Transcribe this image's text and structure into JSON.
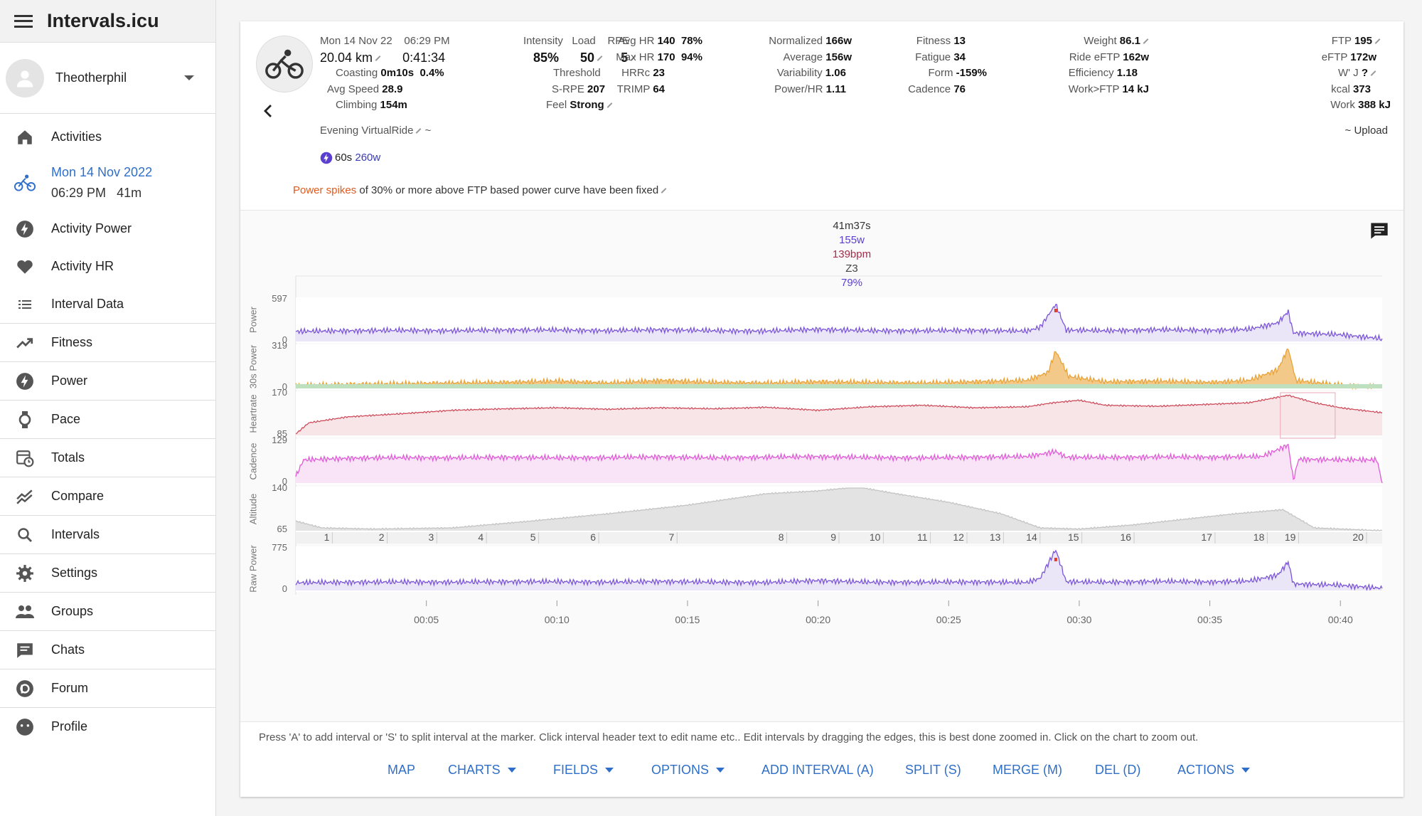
{
  "app": {
    "title": "Intervals.icu"
  },
  "user": {
    "name": "Theotherphil"
  },
  "sidebar": {
    "items": [
      {
        "label": "Activities",
        "icon": "home-icon"
      },
      {
        "label": "Activity Power",
        "icon": "lightning-icon"
      },
      {
        "label": "Activity HR",
        "icon": "heart-icon"
      },
      {
        "label": "Interval Data",
        "icon": "list-icon"
      },
      {
        "label": "Fitness",
        "icon": "trending-up-icon"
      },
      {
        "label": "Power",
        "icon": "lightning-icon"
      },
      {
        "label": "Pace",
        "icon": "watch-icon"
      },
      {
        "label": "Totals",
        "icon": "calendar-clock-icon"
      },
      {
        "label": "Compare",
        "icon": "compare-icon"
      },
      {
        "label": "Intervals",
        "icon": "search-icon"
      },
      {
        "label": "Settings",
        "icon": "gear-icon"
      },
      {
        "label": "Groups",
        "icon": "people-icon"
      },
      {
        "label": "Chats",
        "icon": "chat-icon"
      },
      {
        "label": "Forum",
        "icon": "discourse-icon"
      },
      {
        "label": "Profile",
        "icon": "profile-icon"
      }
    ],
    "current": {
      "date": "Mon 14 Nov 2022",
      "time": "06:29 PM",
      "duration": "41m"
    }
  },
  "activity": {
    "date": "Mon 14 Nov 22",
    "time": "06:29 PM",
    "distance": "20.04 km",
    "elapsed": "0:41:34",
    "coasting_label": "Coasting",
    "coasting": "0m10s",
    "coasting_pct": "0.4%",
    "avg_speed_label": "Avg Speed",
    "avg_speed": "28.9",
    "climbing_label": "Climbing",
    "climbing": "154m",
    "name": "Evening VirtualRide",
    "name_suffix": "~",
    "peak": "60s",
    "peak_value": "260w",
    "upload": "~ Upload",
    "notice_highlight": "Power spikes",
    "notice_rest": "of 30% or more above FTP based power curve have been fixed"
  },
  "stats": {
    "intensity_label": "Intensity",
    "intensity": "85%",
    "load_label": "Load",
    "load": "50",
    "rpe_label": "RPE",
    "rpe": "5",
    "threshold_label": "Threshold",
    "srpe_label": "S-RPE",
    "srpe": "207",
    "feel_label": "Feel",
    "feel": "Strong",
    "avg_hr_label": "Avg HR",
    "avg_hr": "140",
    "avg_hr_pct": "78%",
    "max_hr_label": "Max HR",
    "max_hr": "170",
    "max_hr_pct": "94%",
    "hrrc_label": "HRRc",
    "hrrc": "23",
    "trimp_label": "TRIMP",
    "trimp": "64",
    "normalized_label": "Normalized",
    "normalized": "166w",
    "average_label": "Average",
    "average": "156w",
    "variability_label": "Variability",
    "variability": "1.06",
    "powerhr_label": "Power/HR",
    "powerhr": "1.11",
    "fitness_label": "Fitness",
    "fitness": "13",
    "fatigue_label": "Fatigue",
    "fatigue": "34",
    "form_label": "Form",
    "form": "-159%",
    "cadence_label": "Cadence",
    "cadence": "76",
    "weight_label": "Weight",
    "weight": "86.1",
    "ride_eftp_label": "Ride eFTP",
    "ride_eftp": "162w",
    "efficiency_label": "Efficiency",
    "efficiency": "1.18",
    "work_ftp_label": "Work>FTP",
    "work_ftp": "14 kJ",
    "ftp_label": "FTP",
    "ftp": "195",
    "eftp_label": "eFTP",
    "eftp": "172w",
    "wj_label": "W' J",
    "wj": "?",
    "kcal_label": "kcal",
    "kcal": "373",
    "work_label": "Work",
    "work": "388 kJ"
  },
  "summary": {
    "duration": "41m37s",
    "power": "155w",
    "hr": "139bpm",
    "zone": "Z3",
    "pct": "79%"
  },
  "chart_data": {
    "type": "line",
    "x_ticks": [
      "00:05",
      "00:10",
      "00:15",
      "00:20",
      "00:25",
      "00:30",
      "00:35",
      "00:40"
    ],
    "x_tick_minutes": [
      5,
      10,
      15,
      20,
      25,
      30,
      35,
      40
    ],
    "x_range_minutes": [
      0,
      41.6
    ],
    "km_markers": [
      "1",
      "2",
      "3",
      "4",
      "5",
      "6",
      "7",
      "8",
      "9",
      "10",
      "11",
      "12",
      "13",
      "14",
      "15",
      "16",
      "17",
      "18",
      "19",
      "20"
    ],
    "km_marker_minutes": [
      1.4,
      3.5,
      5.4,
      7.3,
      9.3,
      11.6,
      14.6,
      18.8,
      20.8,
      22.5,
      24.3,
      25.7,
      27.1,
      28.5,
      30.1,
      32.1,
      35.2,
      37.2,
      38.4,
      41.0
    ],
    "panels": [
      {
        "name": "Power",
        "ymin_label": "0",
        "ymax_label": "597",
        "ymax": 597,
        "color": "#7b55d9",
        "fill": "#ebe6f7",
        "points": [
          [
            0,
            140
          ],
          [
            2,
            150
          ],
          [
            4,
            155
          ],
          [
            6,
            150
          ],
          [
            8,
            160
          ],
          [
            10,
            160
          ],
          [
            12,
            150
          ],
          [
            14,
            165
          ],
          [
            16,
            150
          ],
          [
            18,
            145
          ],
          [
            20,
            170
          ],
          [
            22,
            150
          ],
          [
            24,
            150
          ],
          [
            26,
            155
          ],
          [
            28,
            145
          ],
          [
            28.5,
            200
          ],
          [
            29.1,
            520
          ],
          [
            29.5,
            160
          ],
          [
            31,
            150
          ],
          [
            33,
            165
          ],
          [
            35,
            155
          ],
          [
            36.5,
            170
          ],
          [
            37.6,
            260
          ],
          [
            38,
            420
          ],
          [
            38.2,
            120
          ],
          [
            40,
            95
          ],
          [
            41.6,
            40
          ]
        ]
      },
      {
        "name": "30s Power",
        "ymin_label": "0",
        "ymax_label": "319",
        "ymax": 319,
        "color": "#e8a33a",
        "fill": "#f3c98a",
        "points": [
          [
            0,
            20
          ],
          [
            2,
            30
          ],
          [
            4,
            35
          ],
          [
            6,
            40
          ],
          [
            8,
            45
          ],
          [
            10,
            55
          ],
          [
            12,
            40
          ],
          [
            14,
            60
          ],
          [
            16,
            45
          ],
          [
            18,
            40
          ],
          [
            20,
            50
          ],
          [
            22,
            45
          ],
          [
            24,
            40
          ],
          [
            26,
            50
          ],
          [
            28,
            60
          ],
          [
            28.8,
            120
          ],
          [
            29.1,
            280
          ],
          [
            29.6,
            90
          ],
          [
            31,
            50
          ],
          [
            33,
            55
          ],
          [
            35,
            45
          ],
          [
            36.5,
            60
          ],
          [
            37.6,
            140
          ],
          [
            38,
            300
          ],
          [
            38.3,
            60
          ],
          [
            40,
            25
          ],
          [
            41.6,
            10
          ]
        ]
      },
      {
        "name": "Heartrate",
        "ymin_label": "85",
        "ymax_label": "170",
        "ymax": 170,
        "ymin": 85,
        "color": "#cf4d5c",
        "fill": "#f8e5e8",
        "points": [
          [
            0,
            88
          ],
          [
            0.5,
            110
          ],
          [
            2,
            122
          ],
          [
            4,
            128
          ],
          [
            6,
            135
          ],
          [
            8,
            138
          ],
          [
            10,
            140
          ],
          [
            12,
            137
          ],
          [
            14,
            140
          ],
          [
            16,
            138
          ],
          [
            18,
            141
          ],
          [
            20,
            135
          ],
          [
            22,
            142
          ],
          [
            24,
            145
          ],
          [
            26,
            140
          ],
          [
            28,
            142
          ],
          [
            29,
            150
          ],
          [
            30,
            155
          ],
          [
            31,
            145
          ],
          [
            33,
            143
          ],
          [
            35,
            147
          ],
          [
            36.5,
            150
          ],
          [
            37.5,
            160
          ],
          [
            38,
            165
          ],
          [
            39,
            150
          ],
          [
            40,
            140
          ],
          [
            41.6,
            130
          ]
        ]
      },
      {
        "name": "Cadence",
        "ymin_label": "0",
        "ymax_label": "129",
        "ymax": 129,
        "color": "#e05ad8",
        "fill": "#f8e4f6",
        "points": [
          [
            0,
            20
          ],
          [
            0.3,
            70
          ],
          [
            2,
            75
          ],
          [
            4,
            77
          ],
          [
            6,
            76
          ],
          [
            8,
            78
          ],
          [
            10,
            76
          ],
          [
            12,
            77
          ],
          [
            14,
            79
          ],
          [
            16,
            76
          ],
          [
            18,
            78
          ],
          [
            20,
            80
          ],
          [
            22,
            77
          ],
          [
            24,
            76
          ],
          [
            26,
            78
          ],
          [
            28,
            80
          ],
          [
            29.1,
            95
          ],
          [
            29.5,
            78
          ],
          [
            31,
            77
          ],
          [
            33,
            79
          ],
          [
            35,
            78
          ],
          [
            37,
            80
          ],
          [
            38,
            115
          ],
          [
            38.2,
            10
          ],
          [
            38.4,
            72
          ],
          [
            40,
            70
          ],
          [
            41.4,
            70
          ],
          [
            41.6,
            0
          ]
        ]
      },
      {
        "name": "Altitude",
        "ymin_label": "65",
        "ymax_label": "140",
        "ymax": 140,
        "ymin": 65,
        "color": "#c4c4c4",
        "fill": "#e3e3e3",
        "points": [
          [
            0,
            82
          ],
          [
            1,
            70
          ],
          [
            3,
            68
          ],
          [
            6,
            70
          ],
          [
            9,
            82
          ],
          [
            12,
            95
          ],
          [
            15,
            110
          ],
          [
            18,
            130
          ],
          [
            20,
            135
          ],
          [
            21.5,
            142
          ],
          [
            23,
            130
          ],
          [
            25,
            115
          ],
          [
            27,
            95
          ],
          [
            28.5,
            70
          ],
          [
            30,
            68
          ],
          [
            32,
            75
          ],
          [
            34,
            85
          ],
          [
            36,
            95
          ],
          [
            37.8,
            102
          ],
          [
            39,
            70
          ],
          [
            41.6,
            65
          ]
        ]
      },
      {
        "name": "Raw Power",
        "ymin_label": "0",
        "ymax_label": "775",
        "ymax": 775,
        "color": "#7b55d9",
        "fill": "#ebe6f7",
        "points": [
          [
            0,
            140
          ],
          [
            2,
            150
          ],
          [
            4,
            155
          ],
          [
            6,
            150
          ],
          [
            8,
            160
          ],
          [
            10,
            160
          ],
          [
            12,
            150
          ],
          [
            14,
            165
          ],
          [
            16,
            150
          ],
          [
            18,
            145
          ],
          [
            20,
            180
          ],
          [
            22,
            150
          ],
          [
            24,
            150
          ],
          [
            26,
            155
          ],
          [
            28,
            145
          ],
          [
            28.5,
            220
          ],
          [
            29.1,
            740
          ],
          [
            29.5,
            160
          ],
          [
            31,
            150
          ],
          [
            33,
            165
          ],
          [
            35,
            155
          ],
          [
            36.5,
            170
          ],
          [
            37.6,
            280
          ],
          [
            38,
            520
          ],
          [
            38.2,
            120
          ],
          [
            40,
            95
          ],
          [
            41.6,
            40
          ]
        ]
      }
    ]
  },
  "help_text": "Press 'A' to add interval or 'S' to split interval at the marker. Click interval header text to edit name etc.. Edit intervals by dragging the edges, this is best done zoomed in. Click on the chart to zoom out.",
  "actions": {
    "map": "MAP",
    "charts": "CHARTS",
    "fields": "FIELDS",
    "options": "OPTIONS",
    "add_interval": "ADD INTERVAL (A)",
    "split": "SPLIT (S)",
    "merge": "MERGE (M)",
    "del": "DEL (D)",
    "actions": "ACTIONS"
  }
}
